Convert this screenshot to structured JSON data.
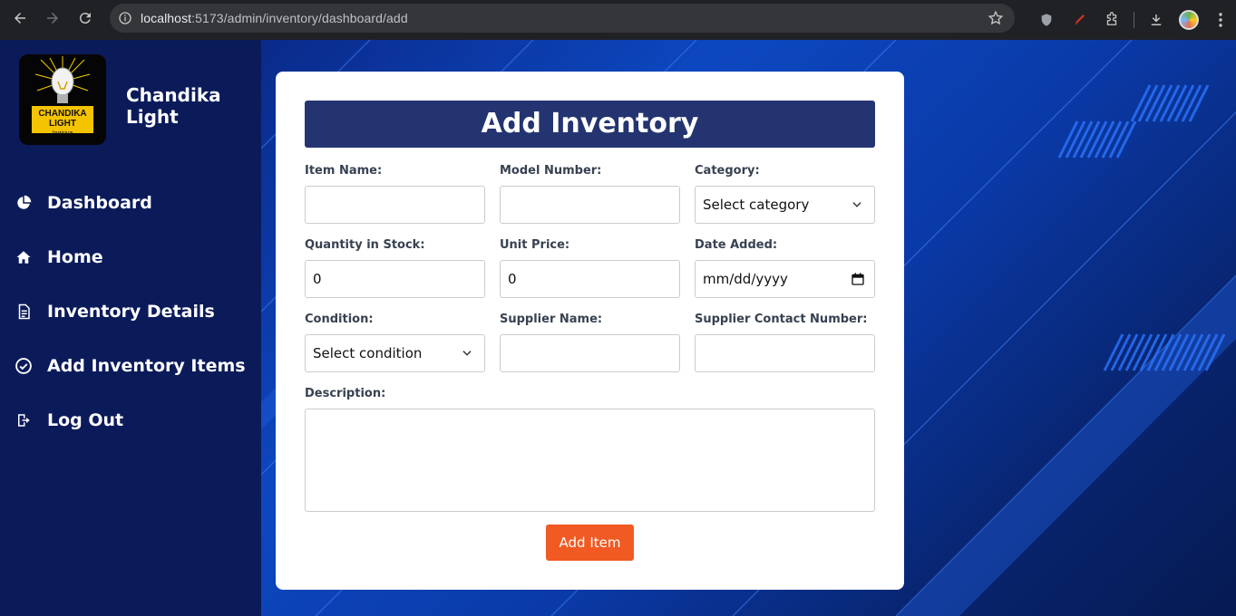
{
  "browser": {
    "url_host": "localhost",
    "url_path": ":5173/admin/inventory/dashboard/add"
  },
  "sidebar": {
    "brand_name": "Chandika Light",
    "logo_text": [
      "CHANDIKA",
      "LIGHT",
      "Ingiriya"
    ],
    "items": [
      {
        "label": "Dashboard",
        "icon": "pie-chart-icon"
      },
      {
        "label": "Home",
        "icon": "home-icon"
      },
      {
        "label": "Inventory Details",
        "icon": "document-icon"
      },
      {
        "label": "Add Inventory Items",
        "icon": "check-circle-icon"
      },
      {
        "label": "Log Out",
        "icon": "logout-icon"
      }
    ]
  },
  "form": {
    "title": "Add Inventory",
    "item_name": {
      "label": "Item Name:",
      "value": ""
    },
    "model_number": {
      "label": "Model Number:",
      "value": ""
    },
    "category": {
      "label": "Category:",
      "value": "Select category"
    },
    "quantity": {
      "label": "Quantity in Stock:",
      "value": "0"
    },
    "unit_price": {
      "label": "Unit Price:",
      "value": "0"
    },
    "date_added": {
      "label": "Date Added:",
      "value": "mm/dd/yyyy"
    },
    "condition": {
      "label": "Condition:",
      "value": "Select condition"
    },
    "supplier_name": {
      "label": "Supplier Name:",
      "value": ""
    },
    "supplier_contact": {
      "label": "Supplier Contact Number:",
      "value": ""
    },
    "description": {
      "label": "Description:",
      "value": ""
    },
    "submit_label": "Add Item"
  },
  "colors": {
    "sidebar_bg": "#0b1b5a",
    "title_bar": "#233470",
    "button": "#f15a22"
  }
}
